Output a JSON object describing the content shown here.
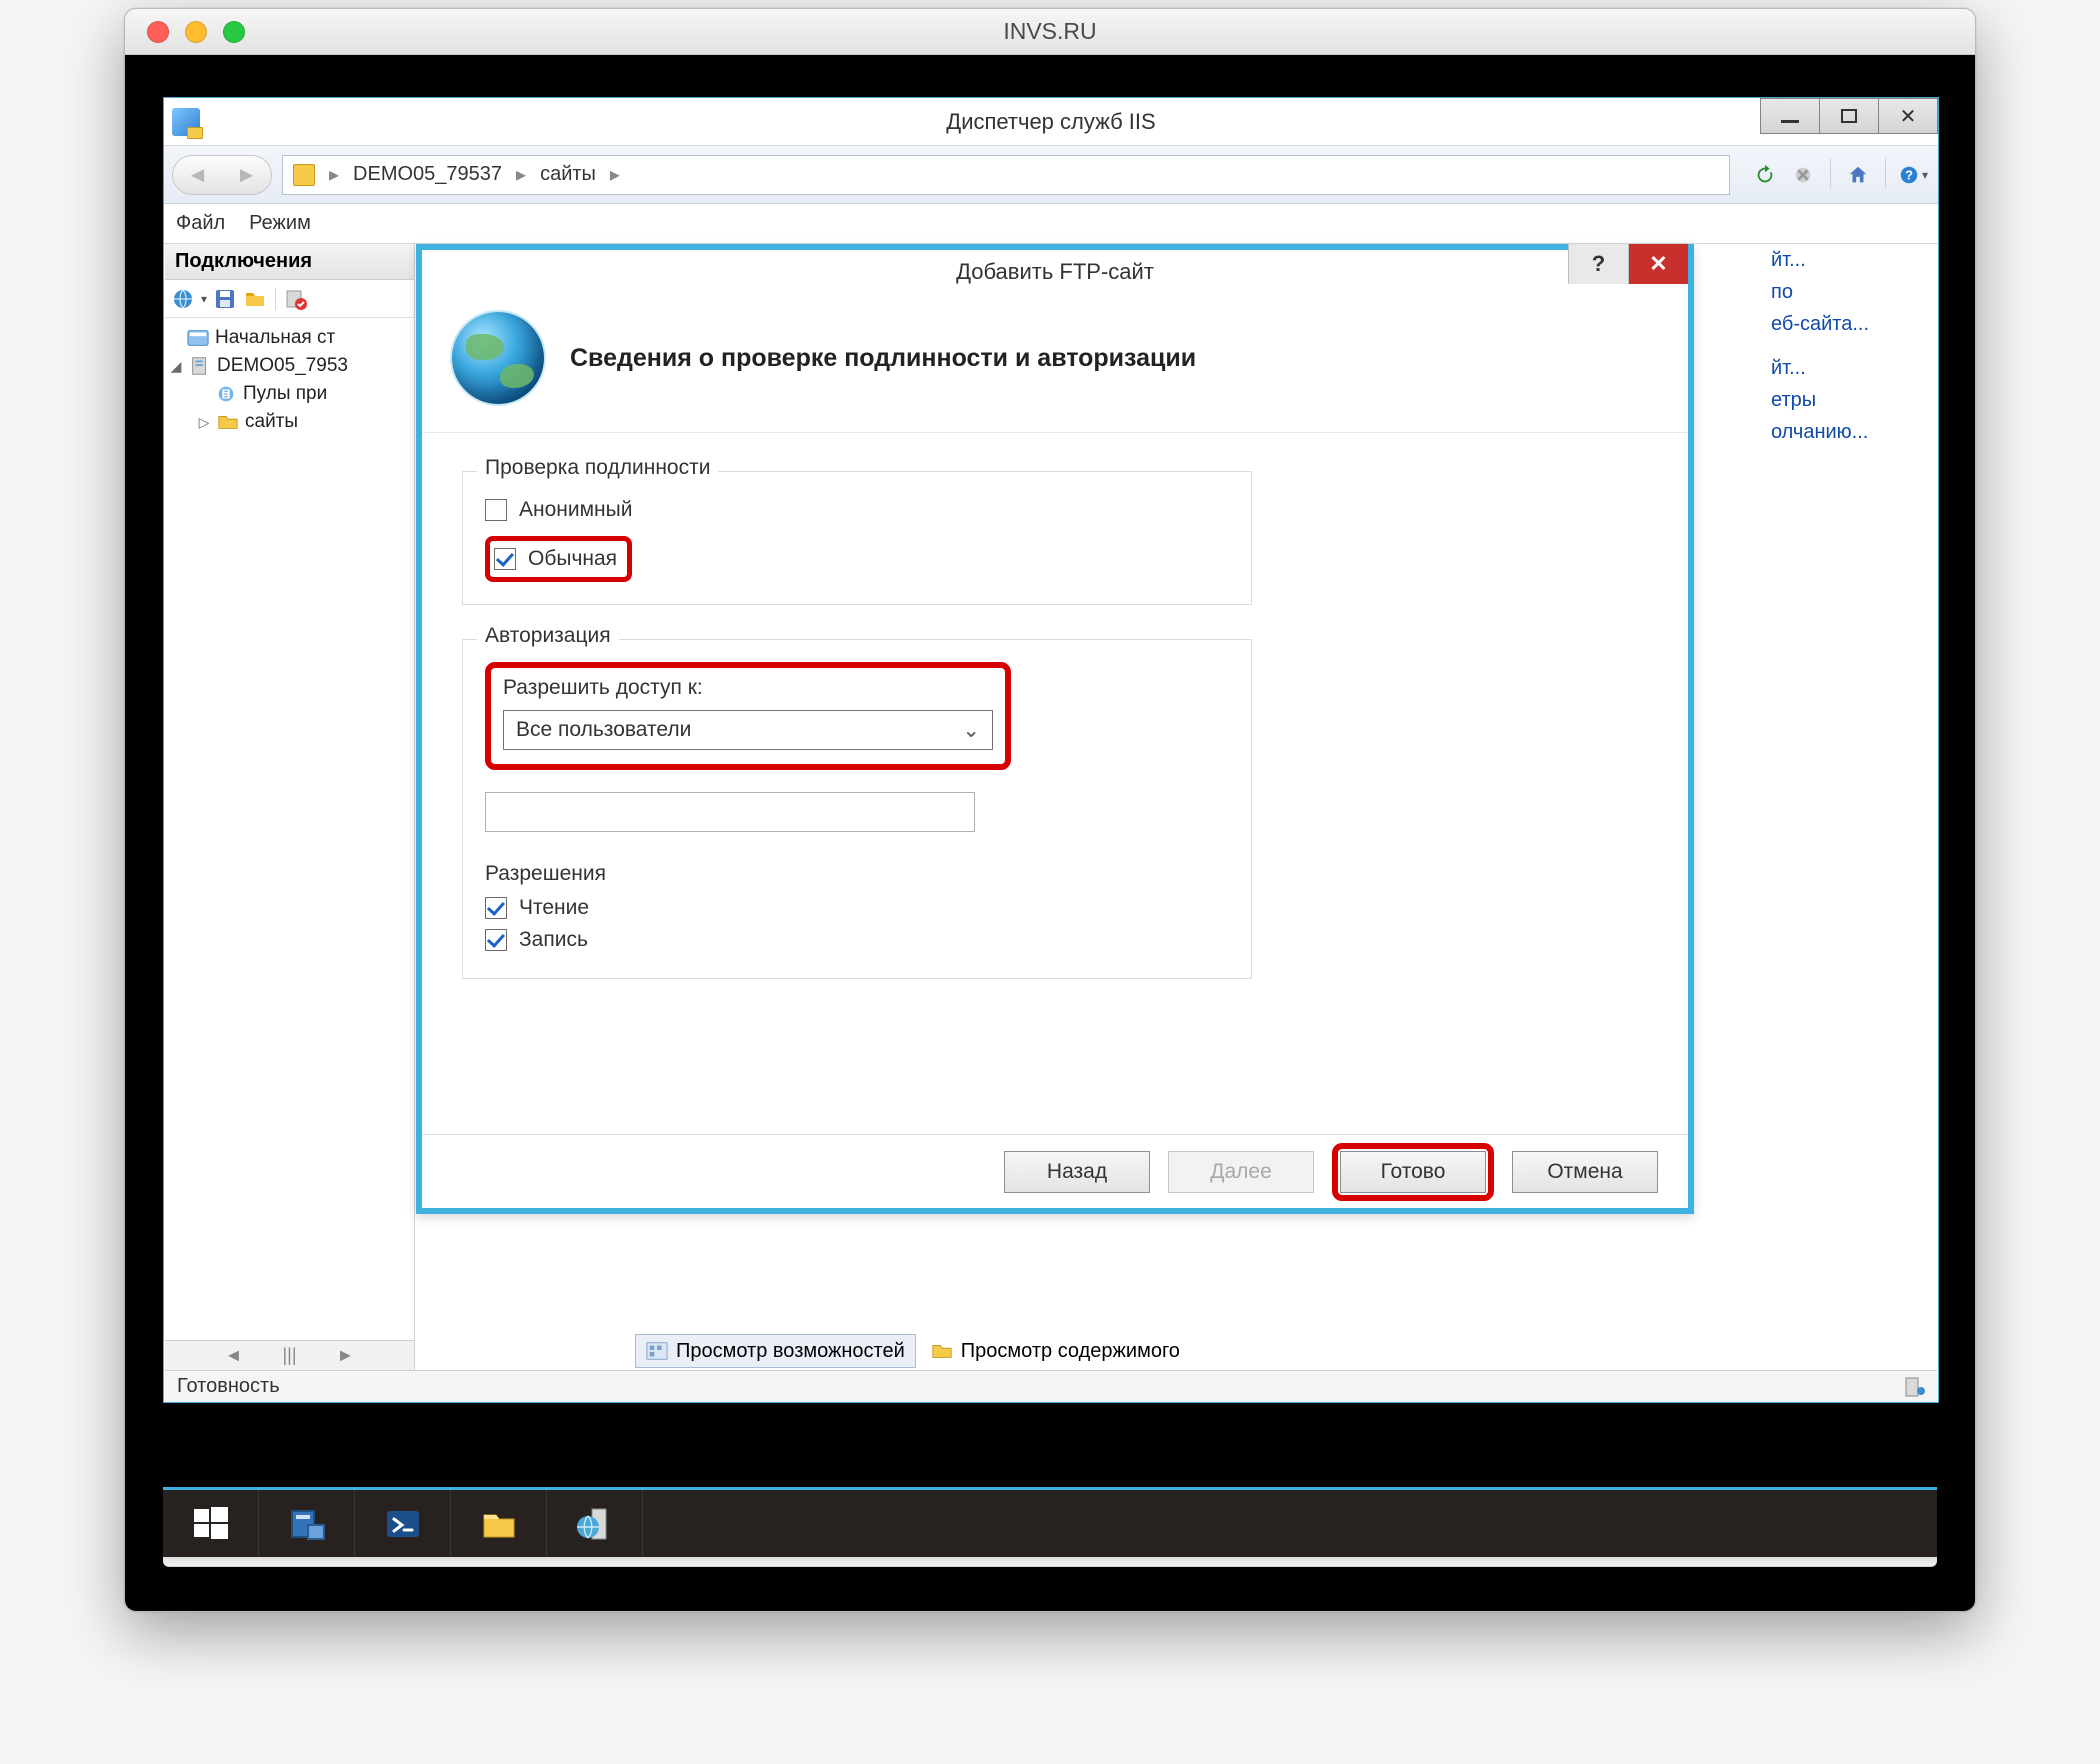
{
  "mac": {
    "title": "INVS.RU"
  },
  "iis": {
    "title": "Диспетчер служб IIS",
    "breadcrumb": {
      "host": "DEMO05_79537",
      "node": "сайты"
    },
    "menu": {
      "file": "Файл",
      "mode": "Режим"
    },
    "sidebar": {
      "title": "Подключения",
      "items": {
        "start": "Начальная ст",
        "host": "DEMO05_7953",
        "pools": "Пулы при",
        "sites": "сайты"
      }
    },
    "rightPanel": {
      "l0": "йт...",
      "l1": "по",
      "l2": "еб-сайта...",
      "l3": "йт...",
      "l4": "етры",
      "l5": "олчанию..."
    },
    "tabs": {
      "features": "Просмотр возможностей",
      "content": "Просмотр содержимого"
    },
    "status": "Готовность"
  },
  "dialog": {
    "title": "Добавить FTP-сайт",
    "heading": "Сведения о проверке подлинности и авторизации",
    "authGroup": "Проверка подлинности",
    "anonymous": "Анонимный",
    "basic": "Обычная",
    "authzGroup": "Авторизация",
    "allowLabel": "Разрешить доступ к:",
    "allowValue": "Все пользователи",
    "permGroup": "Разрешения",
    "read": "Чтение",
    "write": "Запись",
    "back": "Назад",
    "next": "Далее",
    "finish": "Готово",
    "cancel": "Отмена",
    "help": "?",
    "close": "✕"
  }
}
